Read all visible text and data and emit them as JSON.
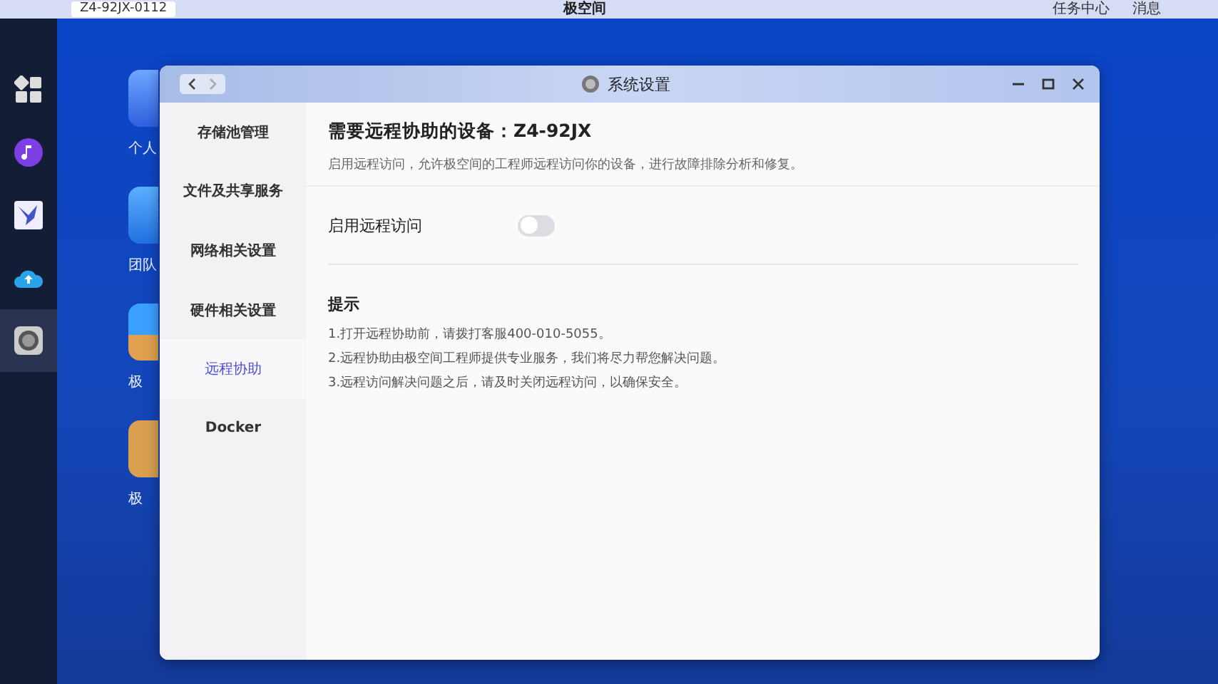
{
  "top_bar": {
    "device": "Z4-92JX-0112",
    "logo": "极空间",
    "task_center": "任务中心",
    "messages": "消息"
  },
  "dock": [
    {
      "kind": "grid",
      "selected": false
    },
    {
      "kind": "music",
      "selected": false
    },
    {
      "kind": "bird",
      "selected": false
    },
    {
      "kind": "cloud",
      "selected": false
    },
    {
      "kind": "settings",
      "selected": true
    }
  ],
  "desktop_icons": [
    {
      "kind": "folder",
      "label": "个人"
    },
    {
      "kind": "team",
      "label": "团队"
    },
    {
      "kind": "photo",
      "label": "极"
    },
    {
      "kind": "box",
      "label": "极"
    }
  ],
  "window": {
    "title": "系统设置",
    "sidebar": [
      {
        "label": "存储池管理",
        "selected": false
      },
      {
        "label": "文件及共享服务",
        "selected": false
      },
      {
        "label": "网络相关设置",
        "selected": false
      },
      {
        "label": "硬件相关设置",
        "selected": false
      },
      {
        "label": "远程协助",
        "selected": true
      },
      {
        "label": "Docker",
        "selected": false
      }
    ],
    "heading": "需要远程协助的设备：Z4-92JX",
    "description": "启用远程访问，允许极空间的工程师远程访问你的设备，进行故障排除分析和修复。",
    "toggle": {
      "label": "启用远程访问",
      "on": false
    },
    "tips_title": "提示",
    "tips": [
      "1.打开远程协助前，请拨打客服400-010-5055。",
      "2.远程协助由极空间工程师提供专业服务，我们将尽力帮您解决问题。",
      "3.远程访问解决问题之后，请及时关闭远程访问，以确保安全。"
    ]
  }
}
